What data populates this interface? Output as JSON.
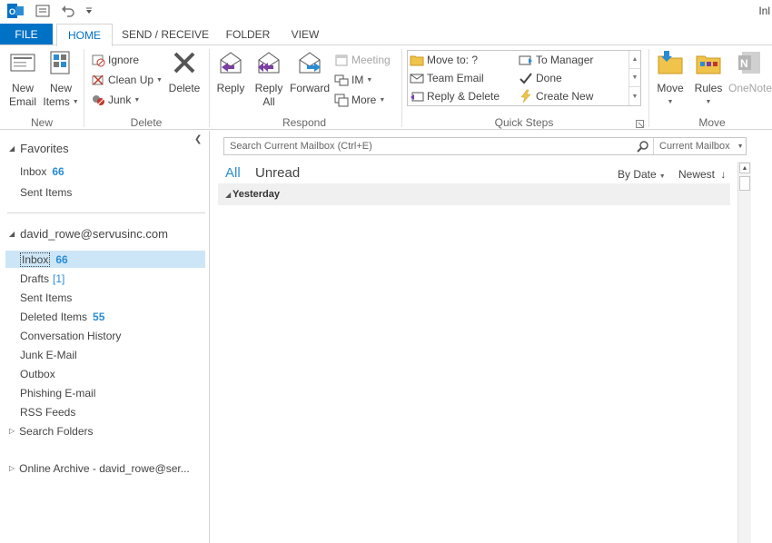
{
  "window": {
    "title_partial": "Inl"
  },
  "tabs": {
    "file": "FILE",
    "items": [
      "HOME",
      "SEND / RECEIVE",
      "FOLDER",
      "VIEW"
    ],
    "active": "HOME"
  },
  "ribbon": {
    "new_group": {
      "label": "New",
      "new_email": [
        "New",
        "Email"
      ],
      "new_items": [
        "New",
        "Items"
      ]
    },
    "delete_group": {
      "label": "Delete",
      "ignore": "Ignore",
      "clean_up": "Clean Up",
      "junk": "Junk",
      "delete": "Delete"
    },
    "respond_group": {
      "label": "Respond",
      "reply": "Reply",
      "reply_all": [
        "Reply",
        "All"
      ],
      "forward": "Forward",
      "meeting": "Meeting",
      "im": "IM",
      "more": "More"
    },
    "quick_steps": {
      "label": "Quick Steps",
      "move_to": "Move to: ?",
      "team_email": "Team Email",
      "reply_delete": "Reply & Delete",
      "to_manager": "To Manager",
      "done": "Done",
      "create_new": "Create New"
    },
    "move_group": {
      "label": "Move",
      "move": "Move",
      "rules": "Rules",
      "onenote": "OneNote"
    }
  },
  "nav": {
    "favorites_header": "Favorites",
    "favorites": [
      {
        "label": "Inbox",
        "count": "66"
      },
      {
        "label": "Sent Items",
        "count": ""
      }
    ],
    "account": "david_rowe@servusinc.com",
    "folders": [
      {
        "label": "Inbox",
        "count": "66"
      },
      {
        "label": "Drafts",
        "count": "[1]"
      },
      {
        "label": "Sent Items",
        "count": ""
      },
      {
        "label": "Deleted Items",
        "count": "55"
      },
      {
        "label": "Conversation History",
        "count": ""
      },
      {
        "label": "Junk E-Mail",
        "count": ""
      },
      {
        "label": "Outbox",
        "count": ""
      },
      {
        "label": "Phishing E-mail",
        "count": ""
      },
      {
        "label": "RSS Feeds",
        "count": ""
      },
      {
        "label": "Search Folders",
        "count": ""
      }
    ],
    "archive": "Online Archive - david_rowe@ser..."
  },
  "main": {
    "search_placeholder": "Search Current Mailbox (Ctrl+E)",
    "search_scope": "Current Mailbox",
    "filter_all": "All",
    "filter_unread": "Unread",
    "sort_by": "By Date",
    "sort_order": "Newest",
    "group_header": "Yesterday"
  },
  "colors": {
    "accent": "#0072c6",
    "count_blue": "#2a8dd4",
    "selected": "#cde6f7"
  }
}
